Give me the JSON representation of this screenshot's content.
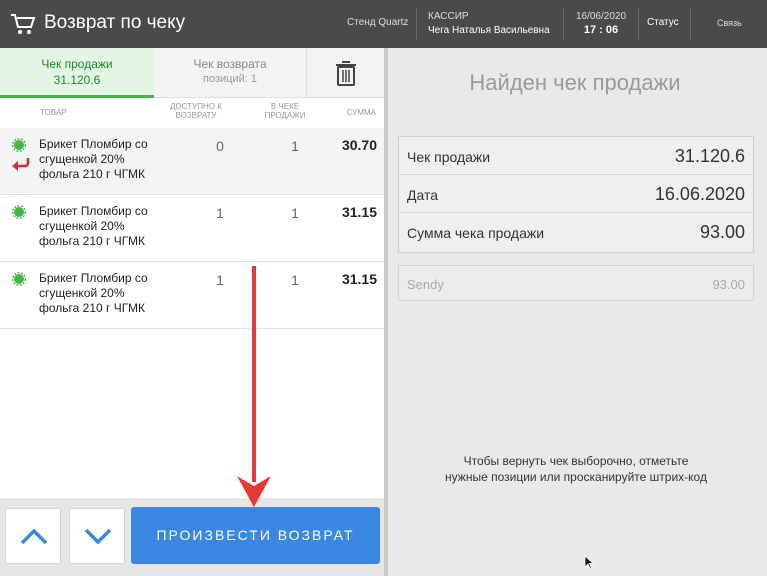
{
  "header": {
    "title": "Возврат по чеку",
    "stand": "Стенд Quartz",
    "cashier_caption": "КАССИР",
    "cashier_name": "Чега Наталья Васильевна",
    "date": "16/06/2020",
    "time": "17 : 06",
    "status": "Статус",
    "link": "Связь"
  },
  "tabs": {
    "sale_label": "Чек продажи",
    "sale_number": "31.120.6",
    "return_label": "Чек возврата",
    "return_positions": "позиций: 1"
  },
  "columns": {
    "item": "ТОВАР",
    "available_l1": "ДОСТУПНО К",
    "available_l2": "ВОЗВРАТУ",
    "in_receipt_l1": "В ЧЕКЕ",
    "in_receipt_l2": "ПРОДАЖИ",
    "sum": "СУММА"
  },
  "rows": [
    {
      "name": "Брикет Пломбир со сгущенкой 20% фольга 210 г ЧГМК",
      "available": "0",
      "in_receipt": "1",
      "sum": "30.70"
    },
    {
      "name": "Брикет Пломбир со сгущенкой 20% фольга 210 г ЧГМК",
      "available": "1",
      "in_receipt": "1",
      "sum": "31.15"
    },
    {
      "name": "Брикет Пломбир со сгущенкой 20% фольга 210 г ЧГМК",
      "available": "1",
      "in_receipt": "1",
      "sum": "31.15"
    }
  ],
  "actions": {
    "return_button": "ПРОИЗВЕСТИ ВОЗВРАТ"
  },
  "details": {
    "found_title": "Найден чек продажи",
    "receipt_label": "Чек продажи",
    "receipt_value": "31.120.6",
    "date_label": "Дата",
    "date_value": "16.06.2020",
    "total_label": "Сумма чека продажи",
    "total_value": "93.00",
    "sendy_label": "Sendy",
    "sendy_value": "93.00",
    "hint_l1": "Чтобы вернуть чек выборочно, отметьте",
    "hint_l2": "нужные позиции или просканируйте штрих-код"
  },
  "colors": {
    "accent_blue": "#3b88e3",
    "active_green": "#1b8a2e",
    "return_red": "#d32f2f",
    "topbar": "#4a4a4a"
  },
  "icons": [
    "cart-icon",
    "trash-icon",
    "status-dot-icon",
    "return-arrow-icon",
    "chevron-up-icon",
    "chevron-down-icon",
    "mouse-cursor-icon"
  ]
}
